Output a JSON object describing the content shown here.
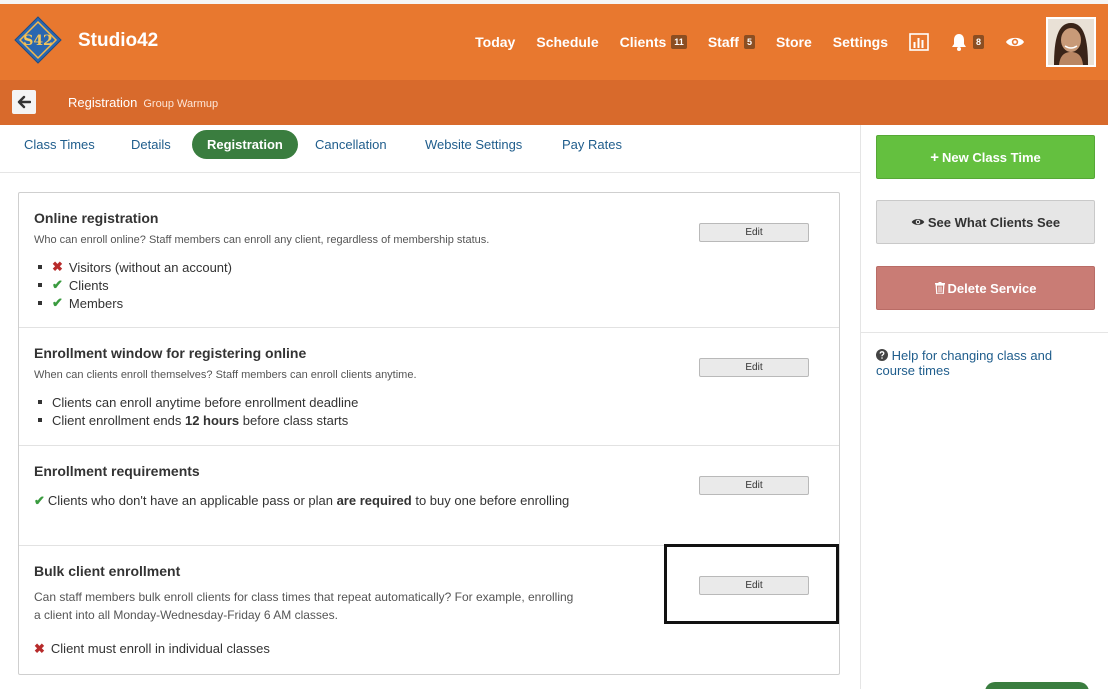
{
  "header": {
    "logo_text": "S42",
    "brand": "Studio42",
    "nav": [
      {
        "label": "Today"
      },
      {
        "label": "Schedule"
      },
      {
        "label": "Clients",
        "badge": "11"
      },
      {
        "label": "Staff",
        "badge": "5"
      },
      {
        "label": "Store"
      },
      {
        "label": "Settings"
      }
    ],
    "notifications_badge": "8",
    "colors": {
      "accent": "#e8782f",
      "subbar": "#d86a2c",
      "active_tab": "#3a7d3f"
    }
  },
  "subbar": {
    "title": "Registration",
    "subtitle": "Group Warmup"
  },
  "tabs": [
    {
      "label": "Class Times"
    },
    {
      "label": "Details"
    },
    {
      "label": "Registration",
      "active": true
    },
    {
      "label": "Cancellation"
    },
    {
      "label": "Website Settings"
    },
    {
      "label": "Pay Rates"
    }
  ],
  "sections": {
    "online": {
      "title": "Online registration",
      "desc": "Who can enroll online? Staff members can enroll any client, regardless of membership status.",
      "items": [
        {
          "status": "no",
          "label": "Visitors (without an account)"
        },
        {
          "status": "yes",
          "label": "Clients"
        },
        {
          "status": "yes",
          "label": "Members"
        }
      ],
      "edit": "Edit"
    },
    "window": {
      "title": "Enrollment window for registering online",
      "desc": "When can clients enroll themselves? Staff members can enroll clients anytime.",
      "item1": "Clients can enroll anytime before enrollment deadline",
      "item2_pre": "Client enrollment ends ",
      "item2_bold": "12 hours",
      "item2_post": " before class starts",
      "edit": "Edit"
    },
    "requirements": {
      "title": "Enrollment requirements",
      "text_pre": "Clients who don't have an applicable pass or plan ",
      "text_bold": "are required",
      "text_post": " to buy one before enrolling",
      "edit": "Edit"
    },
    "bulk": {
      "title": "Bulk client enrollment",
      "desc": "Can staff members bulk enroll clients for class times that repeat automatically? For example, enrolling a client into all Monday-Wednesday-Friday 6 AM classes.",
      "status_text": "Client must enroll in individual classes",
      "edit": "Edit"
    }
  },
  "sidebar": {
    "new_class_time": "New Class Time",
    "see_clients": "See What Clients See",
    "delete_service": "Delete Service",
    "help": "Help for changing class and course times"
  }
}
